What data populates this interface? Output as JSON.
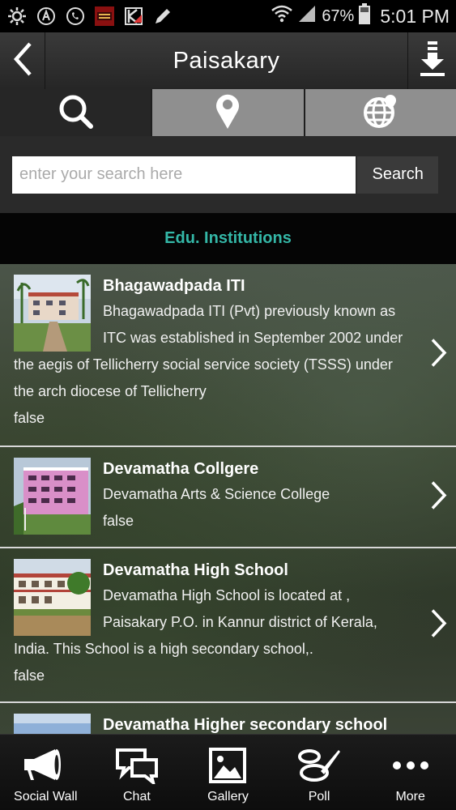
{
  "status_bar": {
    "battery": "67%",
    "time": "5:01 PM"
  },
  "header": {
    "title": "Paisakary"
  },
  "tabs": [
    {
      "icon": "search-icon"
    },
    {
      "icon": "map-pin-icon"
    },
    {
      "icon": "globe-icon"
    }
  ],
  "search": {
    "placeholder": "enter your search here",
    "button_label": "Search"
  },
  "section": {
    "title": "Edu. Institutions"
  },
  "items": [
    {
      "title": "Bhagawadpada ITI",
      "desc": "Bhagawadpada ITI (Pvt) previously known as ITC was established in September 2002 under",
      "extra": "the aegis of Tellicherry social service society (TSSS) under the arch diocese of Tellicherry",
      "flag": "false"
    },
    {
      "title": "Devamatha Collgere",
      "desc": "Devamatha Arts & Science College",
      "flag": "false"
    },
    {
      "title": "Devamatha High School",
      "desc": "Devamatha High School is located at , Paisakary P.O. in Kannur district of Kerala,",
      "extra": "India. This School is a high secondary school,.",
      "flag": "false"
    },
    {
      "title": "Devamatha Higher secondary school"
    }
  ],
  "bottom_nav": [
    {
      "label": "Social Wall",
      "icon": "megaphone-icon"
    },
    {
      "label": "Chat",
      "icon": "chat-bubbles-icon"
    },
    {
      "label": "Gallery",
      "icon": "gallery-icon"
    },
    {
      "label": "Poll",
      "icon": "poll-icon"
    },
    {
      "label": "More",
      "icon": "more-dots-icon"
    }
  ]
}
